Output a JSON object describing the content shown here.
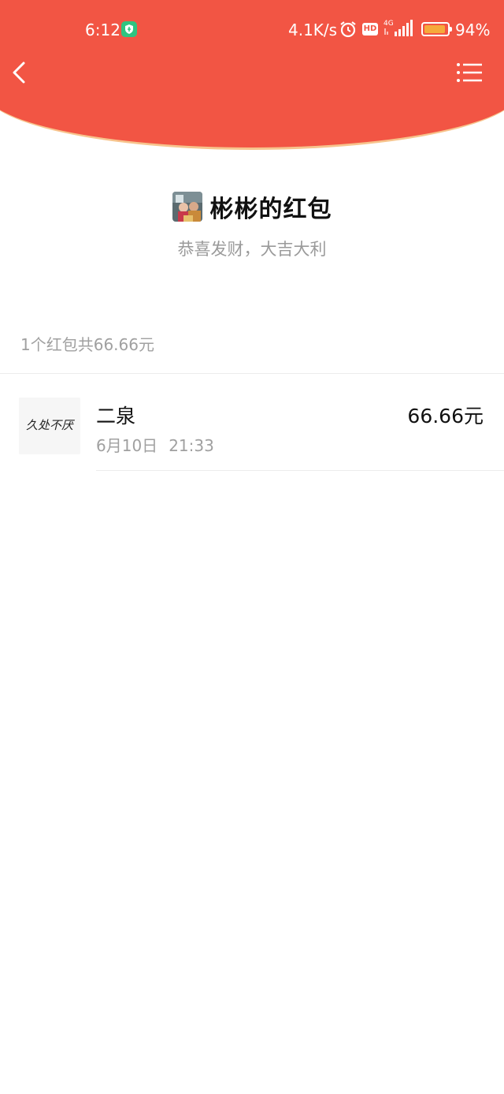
{
  "status_bar": {
    "time": "6:12",
    "net_speed": "4.1K/s",
    "hd_label": "HD",
    "network_type": "4G",
    "battery_percent": "94%",
    "battery_level": 0.94,
    "icons": [
      "shield-icon",
      "alarm-icon",
      "hd-icon",
      "signal-icon",
      "battery-icon"
    ]
  },
  "nav": {
    "back_icon": "chevron-left-icon",
    "menu_icon": "list-menu-icon"
  },
  "header": {
    "title": "彬彬的红包",
    "blessing": "恭喜发财，大吉大利"
  },
  "summary": "1个红包共66.66元",
  "records": [
    {
      "name": "二泉",
      "date": "6月10日",
      "time": "21:33",
      "amount": "66.66元",
      "avatar_text": "久处不厌"
    }
  ],
  "colors": {
    "header_red": "#F25544",
    "header_edge": "#F7C48D",
    "secure_green": "#2FC480",
    "battery_fill": "#F6A93B"
  }
}
